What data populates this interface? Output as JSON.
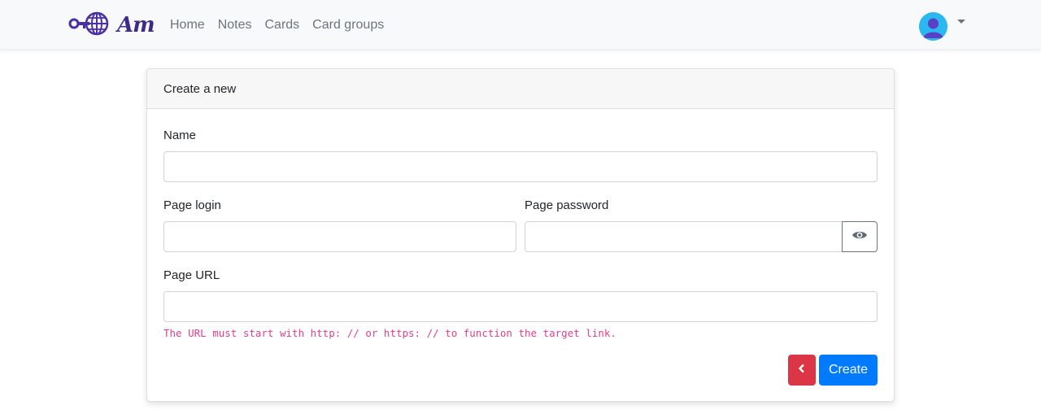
{
  "brand": {
    "logo_text": "Am",
    "logo_icon": "key-globe-logo-icon"
  },
  "nav": {
    "links": [
      "Home",
      "Notes",
      "Cards",
      "Card groups"
    ]
  },
  "user_menu": {
    "avatar_icon": "user-avatar-icon",
    "caret_icon": "caret-down-icon"
  },
  "form": {
    "header": "Create a new",
    "name_label": "Name",
    "name_value": "",
    "login_label": "Page login",
    "login_value": "",
    "password_label": "Page password",
    "password_value": "",
    "toggle_icon": "eye-icon",
    "url_label": "Page URL",
    "url_value": "",
    "url_hint": "The URL must start with http: // or https: // to function the target link.",
    "back_icon": "chevron-left-icon",
    "create_label": "Create"
  },
  "colors": {
    "primary": "#007bff",
    "danger": "#dc3545",
    "hint": "#e83e8c",
    "brand": "#3f2a8c",
    "avatar": "#2bb8f0"
  }
}
